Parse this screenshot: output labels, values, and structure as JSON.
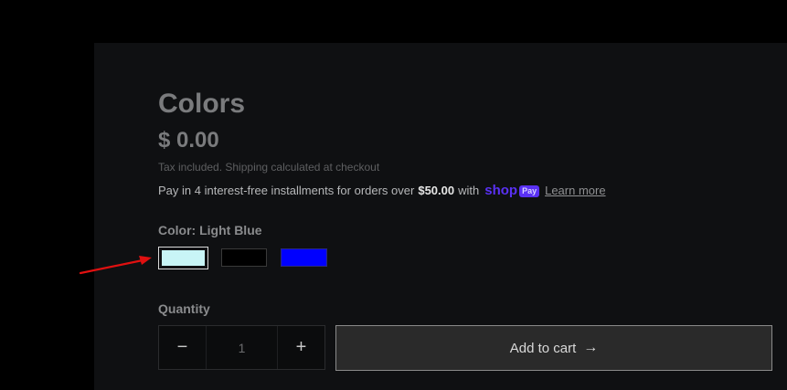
{
  "product": {
    "title": "Colors",
    "price": "$ 0.00",
    "tax_note": "Tax included. Shipping calculated at checkout"
  },
  "installments": {
    "text_prefix": "Pay in 4 interest-free installments for orders over",
    "threshold": "$50.00",
    "text_with": "with",
    "shop_word": "shop",
    "pay_badge": "Pay",
    "learn_more": "Learn more"
  },
  "color_option": {
    "label": "Color: Light Blue",
    "swatches": [
      {
        "name": "Light Blue",
        "hex": "#c8f5f6",
        "selected": true
      },
      {
        "name": "Black",
        "hex": "#000000",
        "selected": false
      },
      {
        "name": "Blue",
        "hex": "#0000ff",
        "selected": false
      }
    ]
  },
  "quantity": {
    "label": "Quantity",
    "value": "1",
    "decrease_symbol": "−",
    "increase_symbol": "+"
  },
  "cart": {
    "add_label": "Add to cart",
    "arrow_icon": "arrow-right-icon"
  },
  "colors": {
    "page_bg": "#000000",
    "panel_bg": "#0f1012",
    "accent_shop": "#5a31f4",
    "annotation_arrow": "#e01010"
  }
}
